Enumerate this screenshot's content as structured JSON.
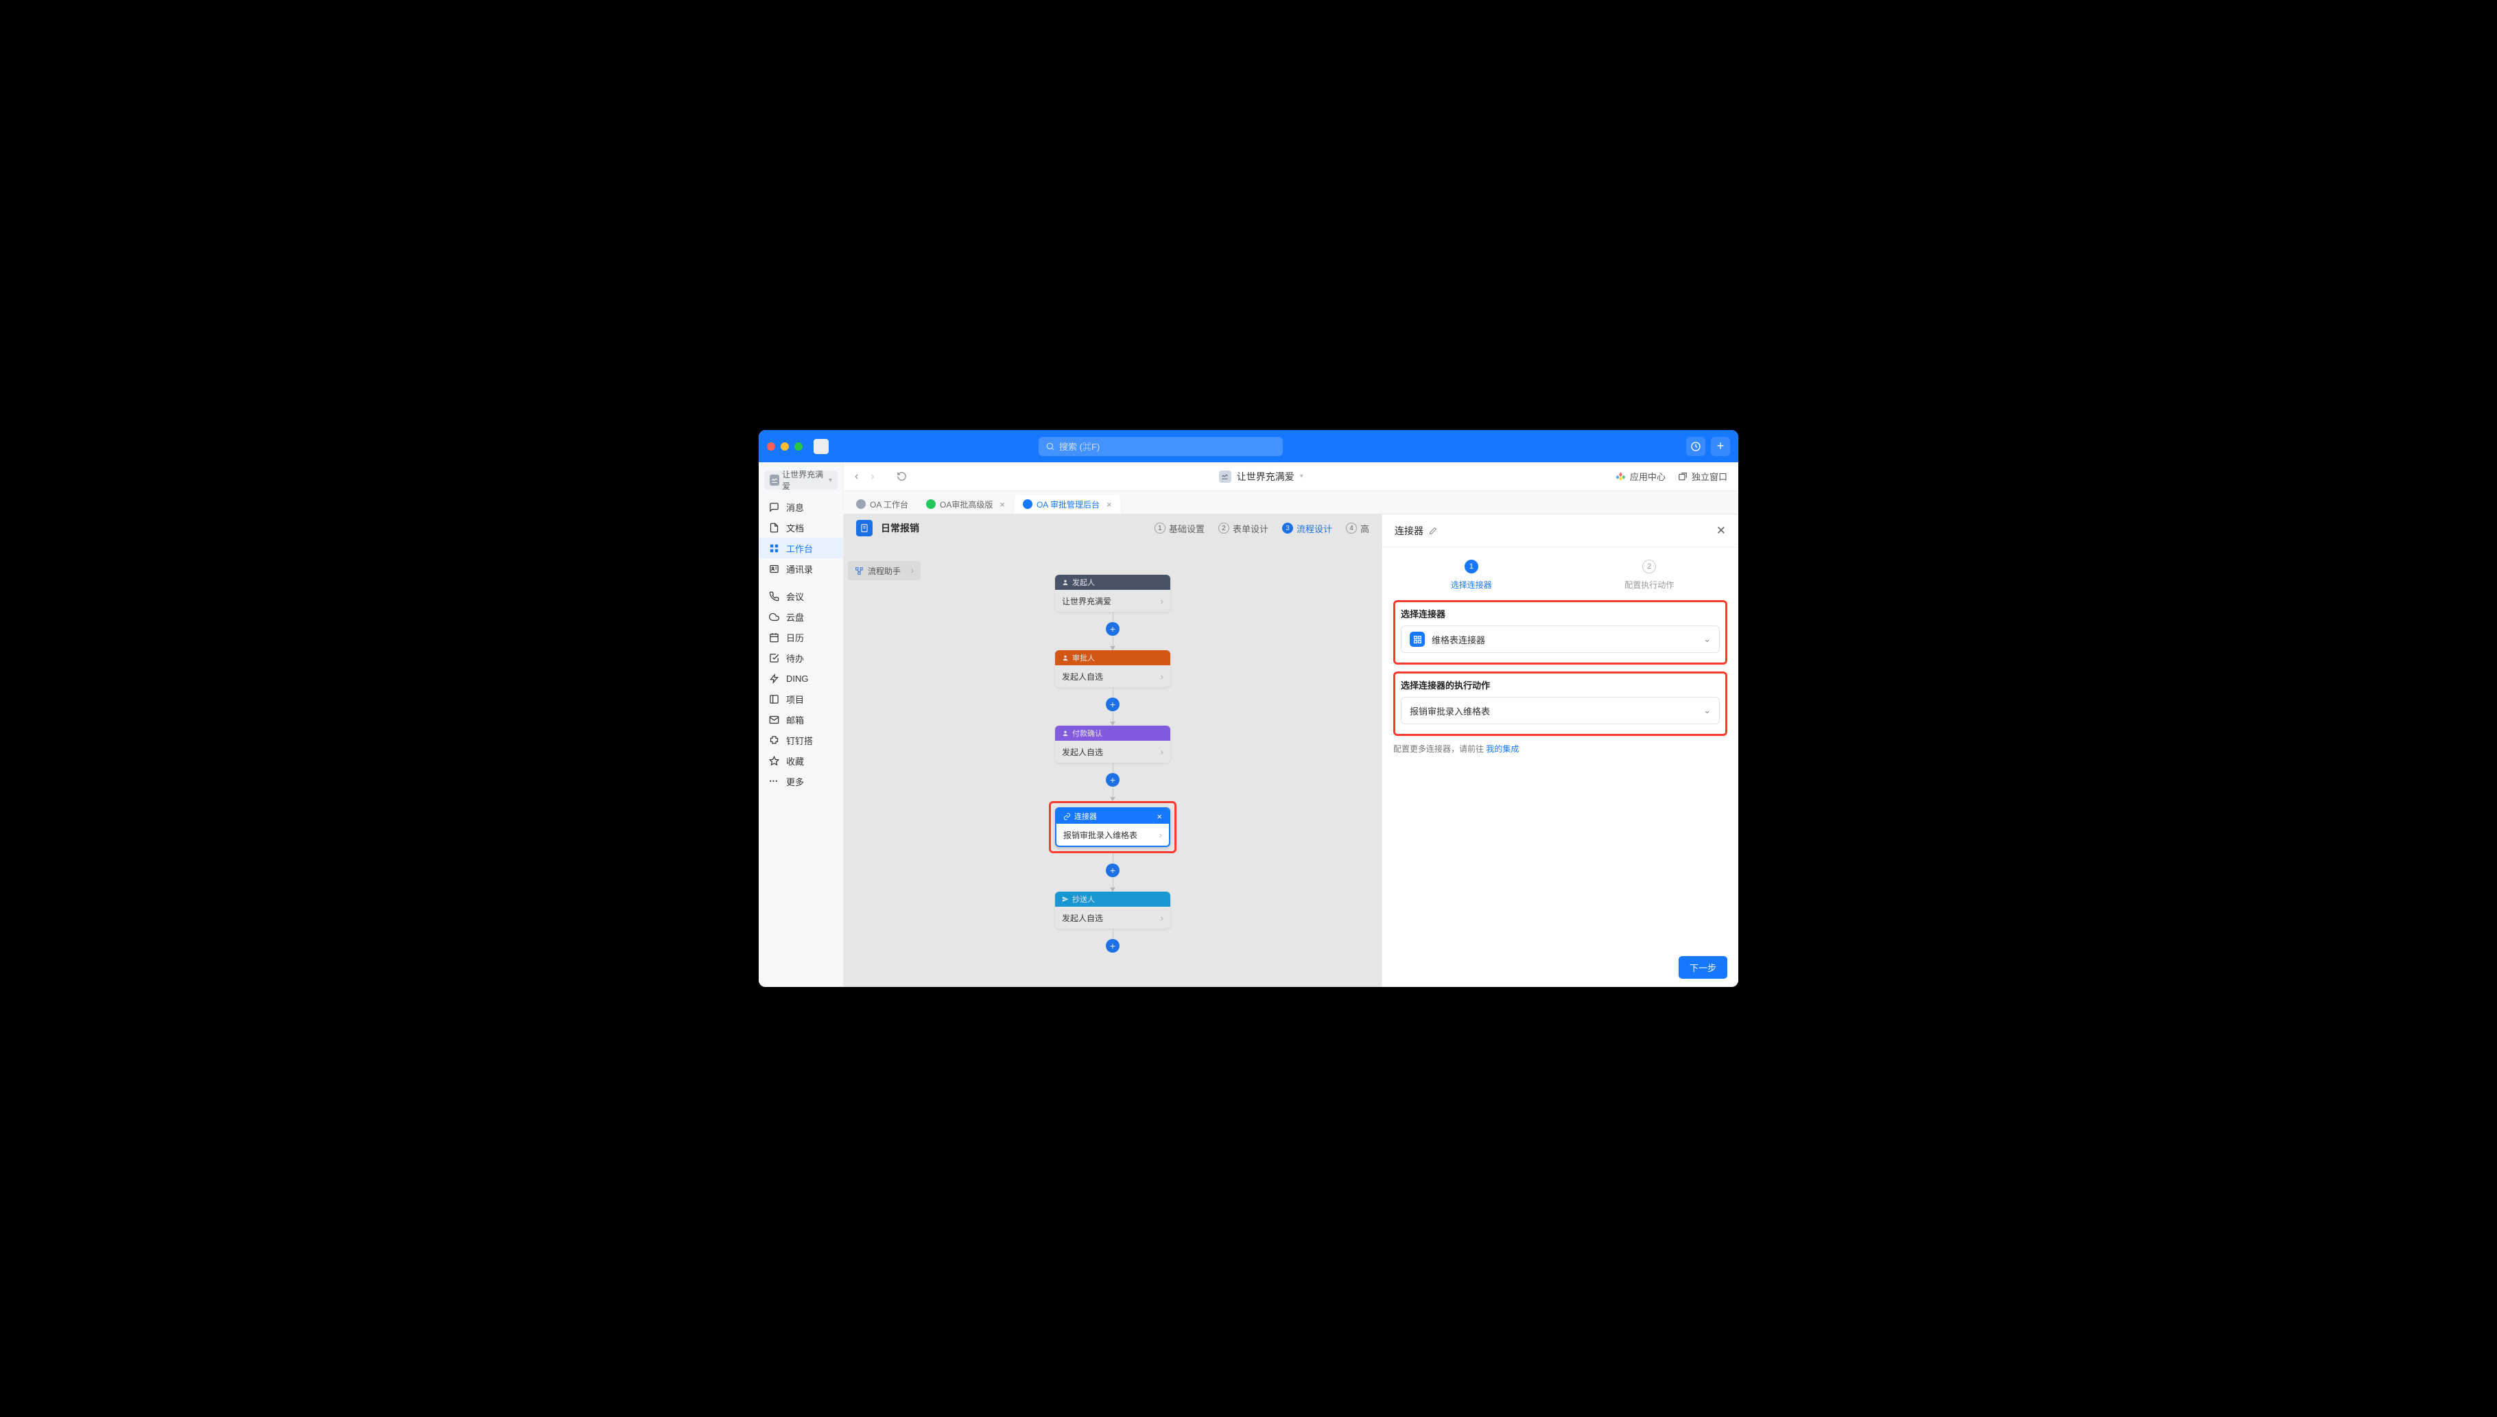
{
  "titlebar": {
    "search_placeholder": "搜索 (⌘F)"
  },
  "org_name": "让世界充满爱",
  "left_nav": [
    {
      "icon": "chat",
      "label": "消息"
    },
    {
      "icon": "doc",
      "label": "文档"
    },
    {
      "icon": "grid",
      "label": "工作台",
      "active": true
    },
    {
      "icon": "contacts",
      "label": "通讯录"
    },
    {
      "icon": "phone",
      "label": "会议"
    },
    {
      "icon": "cloud",
      "label": "云盘"
    },
    {
      "icon": "calendar",
      "label": "日历"
    },
    {
      "icon": "todo",
      "label": "待办"
    },
    {
      "icon": "ding",
      "label": "DING"
    },
    {
      "icon": "project",
      "label": "项目"
    },
    {
      "icon": "mail",
      "label": "邮箱"
    },
    {
      "icon": "puzzle",
      "label": "钉钉搭"
    },
    {
      "icon": "star",
      "label": "收藏"
    },
    {
      "icon": "more",
      "label": "更多"
    }
  ],
  "toolbar": {
    "breadcrumb": "让世界充满爱",
    "app_center": "应用中心",
    "new_window": "独立窗口"
  },
  "tabs": [
    {
      "label": "OA 工作台",
      "color": "#9aa4b2",
      "closable": false
    },
    {
      "label": "OA审批高级版",
      "color": "#22c55e",
      "closable": true
    },
    {
      "label": "OA 审批管理后台",
      "color": "#1677ff",
      "closable": true,
      "active": true
    }
  ],
  "page": {
    "title": "日常报销",
    "steps": [
      {
        "n": "1",
        "label": "基础设置"
      },
      {
        "n": "2",
        "label": "表单设计"
      },
      {
        "n": "3",
        "label": "流程设计",
        "active": true
      },
      {
        "n": "4",
        "label": "高"
      }
    ],
    "flow_helper": "流程助手"
  },
  "flow": {
    "initiator_head": "发起人",
    "initiator_body": "让世界充满爱",
    "approver_head": "审批人",
    "approver_body": "发起人自选",
    "payment_head": "付款确认",
    "payment_body": "发起人自选",
    "connector_head": "连接器",
    "connector_body": "报销审批录入维格表",
    "cc_head": "抄送人",
    "cc_body": "发起人自选"
  },
  "panel": {
    "title": "连接器",
    "step1": "选择连接器",
    "step2": "配置执行动作",
    "section1": "选择连接器",
    "select1": "维格表连接器",
    "section2": "选择连接器的执行动作",
    "select2": "报销审批录入维格表",
    "hint_prefix": "配置更多连接器，请前往 ",
    "hint_link": "我的集成",
    "next": "下一步"
  }
}
